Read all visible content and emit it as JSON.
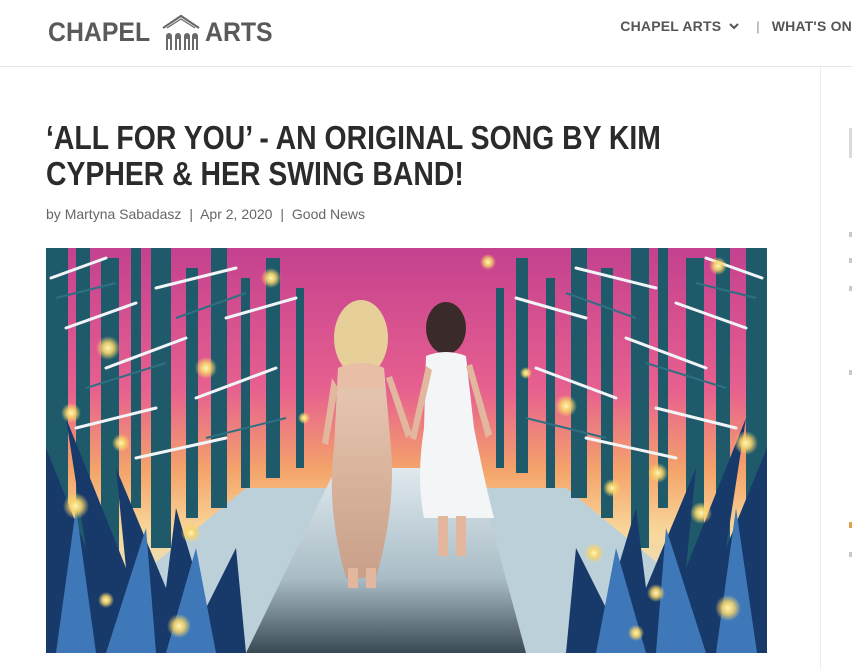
{
  "logo": {
    "left_text": "CHAPEL",
    "right_text": "ARTS"
  },
  "nav": {
    "items": [
      {
        "label": "CHAPEL ARTS"
      },
      {
        "label": "WHAT'S ON"
      }
    ],
    "separator": "|"
  },
  "post": {
    "title": "‘ALL FOR YOU’ - AN ORIGINAL SONG BY KIM CYPHER & HER SWING BAND!",
    "meta": {
      "by": "by",
      "author": "Martyna Sabadasz",
      "date": "Apr 2, 2020",
      "category": "Good News",
      "separator": "|"
    },
    "image_icon": "illustration-image"
  },
  "colors": {
    "logo": "#5a5a5a",
    "nav": "#555555",
    "title": "#2b2b2b",
    "meta": "#666666"
  }
}
